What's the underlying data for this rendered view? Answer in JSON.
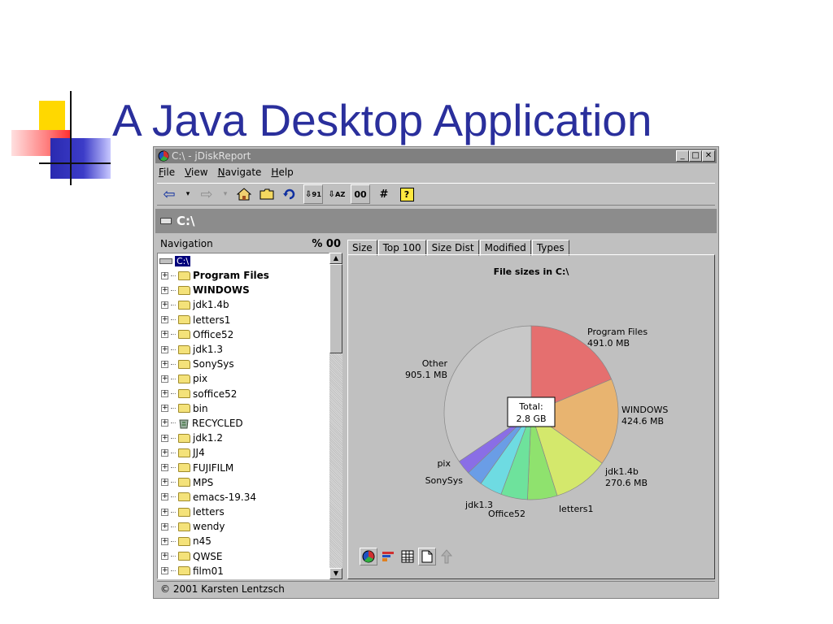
{
  "slide": {
    "title": "A Java Desktop Application"
  },
  "window": {
    "title": "C:\\ - jDiskReport",
    "buttons": {
      "minimize": "_",
      "maximize": "□",
      "close": "✕"
    }
  },
  "menu": {
    "file": "File",
    "view": "View",
    "navigate": "Navigate",
    "help": "Help"
  },
  "toolbar": {
    "back_icon": "⇦",
    "dropdown": "▾",
    "forward_icon": "⇨",
    "home_icon": "home-icon",
    "folder_icon": "folder-icon",
    "refresh_icon": "refresh-icon",
    "sort_size_icon": "sort-numeric-icon",
    "sort_name_icon": "sort-alpha-icon",
    "zero_button": "00",
    "hash_button": "#",
    "help_icon": "?"
  },
  "path": {
    "label": "C:\\"
  },
  "navigation": {
    "title": "Navigation",
    "percent_label": "% 00",
    "root": "C:\\",
    "items": [
      {
        "label": "Program Files",
        "bold": true
      },
      {
        "label": "WINDOWS",
        "bold": true
      },
      {
        "label": "jdk1.4b"
      },
      {
        "label": "letters1"
      },
      {
        "label": "Office52"
      },
      {
        "label": "jdk1.3"
      },
      {
        "label": "SonySys"
      },
      {
        "label": "pix"
      },
      {
        "label": "soffice52"
      },
      {
        "label": "bin"
      },
      {
        "label": "RECYCLED",
        "recycle": true
      },
      {
        "label": "jdk1.2"
      },
      {
        "label": "JJ4"
      },
      {
        "label": "FUJIFILM"
      },
      {
        "label": "MPS"
      },
      {
        "label": "emacs-19.34"
      },
      {
        "label": "letters"
      },
      {
        "label": "wendy"
      },
      {
        "label": "n45"
      },
      {
        "label": "QWSE"
      },
      {
        "label": "film01"
      }
    ]
  },
  "tabs": [
    "Size",
    "Top 100",
    "Size Dist",
    "Modified",
    "Types"
  ],
  "chart_data": {
    "type": "pie",
    "title": "File sizes in C:\\",
    "center_label": [
      "Total:",
      "2.8 GB"
    ],
    "slices": [
      {
        "label": "Program Files",
        "sublabel": "491.0 MB",
        "value": 491.0,
        "color": "#e56f6f"
      },
      {
        "label": "WINDOWS",
        "sublabel": "424.6 MB",
        "value": 424.6,
        "color": "#e8b470"
      },
      {
        "label": "jdk1.4b",
        "sublabel": "270.6 MB",
        "value": 270.6,
        "color": "#d4e86c"
      },
      {
        "label": "letters1",
        "sublabel": "",
        "value": 145,
        "color": "#8fe26e"
      },
      {
        "label": "Office52",
        "sublabel": "",
        "value": 130,
        "color": "#6ee29c"
      },
      {
        "label": "jdk1.3",
        "sublabel": "",
        "value": 110,
        "color": "#6edbe2"
      },
      {
        "label": "SonySys",
        "sublabel": "",
        "value": 80,
        "color": "#6a9de6"
      },
      {
        "label": "pix",
        "sublabel": "",
        "value": 70,
        "color": "#8a6ee6"
      },
      {
        "label": "Other",
        "sublabel": "905.1 MB",
        "value": 905.1,
        "color": "#c8c8c8"
      }
    ]
  },
  "status": {
    "text": "© 2001 Karsten Lentzsch"
  }
}
